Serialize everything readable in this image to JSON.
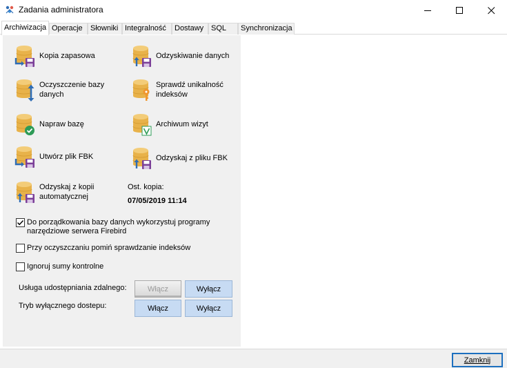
{
  "window": {
    "title": "Zadania administratora",
    "controls": [
      "minimize",
      "maximize",
      "close"
    ]
  },
  "tabs": [
    {
      "label": "Archiwizacja",
      "active": true
    },
    {
      "label": "Operacje",
      "active": false
    },
    {
      "label": "Słowniki",
      "active": false
    },
    {
      "label": "Integralność",
      "active": false
    },
    {
      "label": "Dostawy",
      "active": false
    },
    {
      "label": "SQL",
      "active": false
    },
    {
      "label": "Synchronizacja",
      "active": false
    }
  ],
  "actions": {
    "backup": {
      "line1": "Kopia zapasowa",
      "line2": "",
      "icon": "database-save-icon"
    },
    "recover": {
      "line1": "Odzyskiwanie danych",
      "line2": "",
      "icon": "database-restore-icon"
    },
    "cleanup": {
      "line1": "Oczyszczenie bazy",
      "line2": "danych",
      "icon": "database-cleanup-icon"
    },
    "check_unique": {
      "line1": "Sprawdź unikalność",
      "line2": "indeksów",
      "icon": "database-key-icon"
    },
    "repair": {
      "line1": "Napraw bazę",
      "line2": "",
      "icon": "database-check-icon"
    },
    "archive_visits": {
      "line1": "Archiwum wizyt",
      "line2": "",
      "icon": "database-archive-icon"
    },
    "create_fbk": {
      "line1": "Utwórz plik FBK",
      "line2": "",
      "icon": "database-save-icon"
    },
    "recover_fbk": {
      "line1": "Odzyskaj z pliku FBK",
      "line2": "",
      "icon": "database-restore-icon"
    },
    "recover_auto": {
      "line1": "Odzyskaj z kopii",
      "line2": "automatycznej",
      "icon": "database-restore-icon"
    }
  },
  "last_backup": {
    "label": "Ost. kopia:",
    "value": "07/05/2019 11:14"
  },
  "options": [
    {
      "line1": "Do porządkowania bazy danych wykorzystuj programy",
      "line2": "narzędziowe serwera Firebird",
      "checked": true
    },
    {
      "line1": "Przy oczyszczaniu pomiń sprawdzanie indeksów",
      "line2": "",
      "checked": false
    },
    {
      "line1": "Ignoruj sumy kontrolne",
      "line2": "",
      "checked": false
    }
  ],
  "remote_sharing": {
    "label": "Usługa udostępniania zdalnego:",
    "enable": "Włącz",
    "disable": "Wyłącz",
    "enable_disabled": true
  },
  "exclusive_access": {
    "label": "Tryb wyłącznego dostepu:",
    "enable": "Włącz",
    "disable": "Wyłącz"
  },
  "footer": {
    "close_label": "Zamknij"
  },
  "colors": {
    "panel_bg": "#f0f0f0",
    "button_bg": "#c7dbf3",
    "db_gold": "#e8b24a",
    "accent_purple": "#7b3f98",
    "accent_blue": "#2f6db5",
    "accent_green": "#2e9b57"
  }
}
